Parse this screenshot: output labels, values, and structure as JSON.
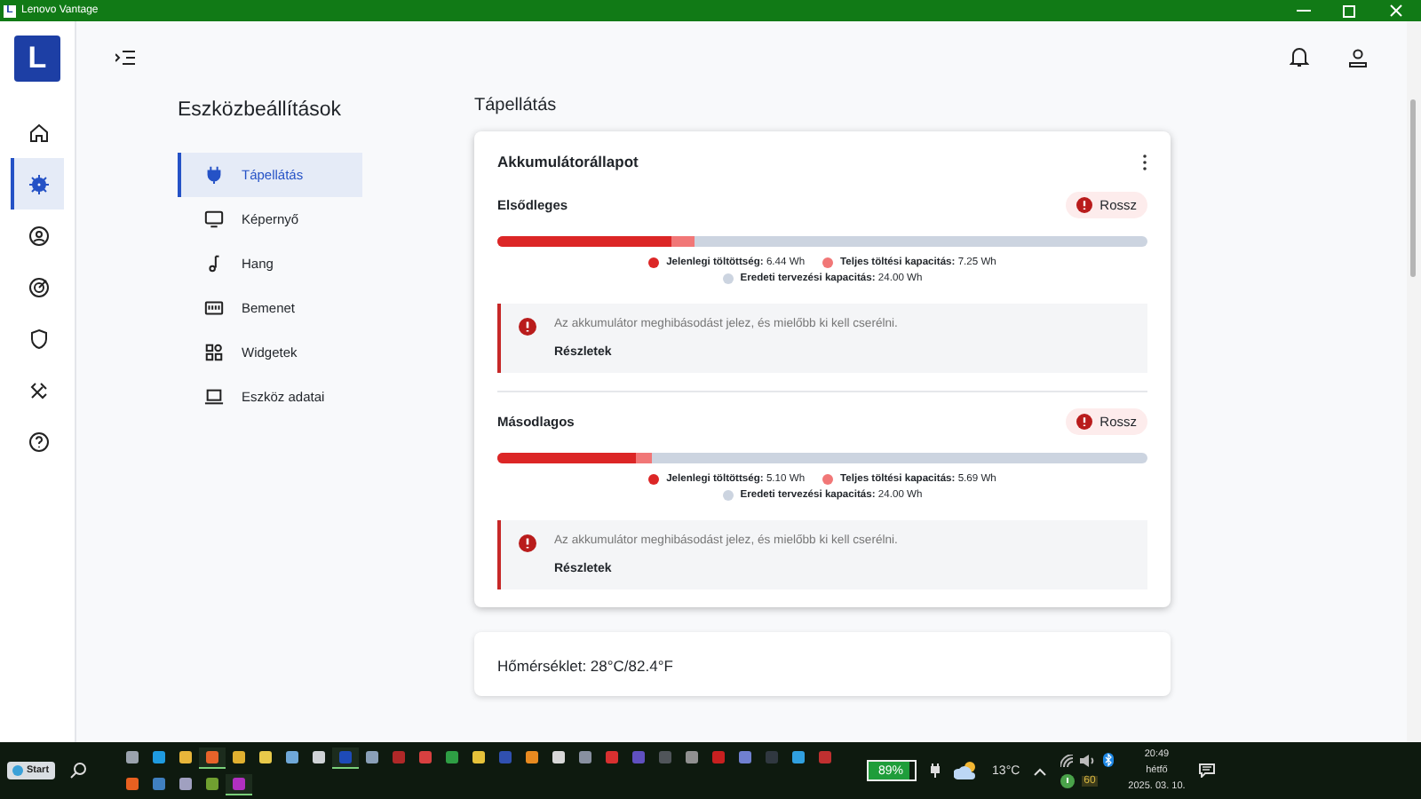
{
  "window": {
    "title": "Lenovo Vantage",
    "logo": "L"
  },
  "rail": {
    "logo": "L",
    "items": [
      {
        "kind": "home",
        "selected": false
      },
      {
        "kind": "gear",
        "selected": true
      },
      {
        "kind": "account",
        "selected": false
      },
      {
        "kind": "target",
        "selected": false
      },
      {
        "kind": "shield",
        "selected": false
      },
      {
        "kind": "tools",
        "selected": false
      },
      {
        "kind": "help",
        "selected": false
      }
    ]
  },
  "settings": {
    "title": "Eszközbeállítások",
    "items": [
      {
        "label": "Tápellátás",
        "kind": "plug",
        "selected": true
      },
      {
        "label": "Képernyő",
        "kind": "monitor",
        "selected": false
      },
      {
        "label": "Hang",
        "kind": "note",
        "selected": false
      },
      {
        "label": "Bemenet",
        "kind": "keyboard",
        "selected": false
      },
      {
        "label": "Widgetek",
        "kind": "widgets",
        "selected": false
      },
      {
        "label": "Eszköz adatai",
        "kind": "laptop",
        "selected": false
      }
    ]
  },
  "page": {
    "title": "Tápellátás"
  },
  "battery_card": {
    "title": "Akkumulátorállapot",
    "batteries": [
      {
        "name": "Elsődleges",
        "status": "Rossz",
        "current_label": "Jelenlegi töltöttség:",
        "current_value": "6.44 Wh",
        "full_label": "Teljes töltési kapacitás:",
        "full_value": "7.25 Wh",
        "design_label": "Eredeti tervezési kapacitás:",
        "design_value": "24.00 Wh",
        "charge": {
          "level": 0.268
        },
        "full_capacity": {
          "level": 0.302
        },
        "alert": "Az akkumulátor meghibásodást jelez, és mielőbb ki kell cserélni.",
        "details": "Részletek"
      },
      {
        "name": "Másodlagos",
        "status": "Rossz",
        "current_label": "Jelenlegi töltöttség:",
        "current_value": "5.10 Wh",
        "full_label": "Teljes töltési kapacitás:",
        "full_value": "5.69 Wh",
        "design_label": "Eredeti tervezési kapacitás:",
        "design_value": "24.00 Wh",
        "charge": {
          "level": 0.2125
        },
        "full_capacity": {
          "level": 0.237
        },
        "alert": "Az akkumulátor meghibásodást jelez, és mielőbb ki kell cserélni.",
        "details": "Részletek"
      }
    ]
  },
  "temperature_card": {
    "label": "Hőmérséklet:",
    "value": "28°C/82.4°F"
  },
  "taskbar": {
    "start": "Start",
    "apps": [
      {
        "color": "#9aa3ad",
        "active": false
      },
      {
        "color": "#1f9be0",
        "active": false
      },
      {
        "color": "#e8b53a",
        "active": false
      },
      {
        "color": "#e8632a",
        "active": true
      },
      {
        "color": "#e0b030",
        "active": false
      },
      {
        "color": "#e8c94a",
        "active": false
      },
      {
        "color": "#6fa8d8",
        "active": false
      },
      {
        "color": "#cfd3d6",
        "active": false
      },
      {
        "color": "#1e4bb8",
        "active": true
      },
      {
        "color": "#8aa0b8",
        "active": false
      },
      {
        "color": "#b02828",
        "active": false
      },
      {
        "color": "#d84040",
        "active": false
      },
      {
        "color": "#2e9e44",
        "active": false
      },
      {
        "color": "#e6c23a",
        "active": false
      },
      {
        "color": "#3050b0",
        "active": false
      },
      {
        "color": "#e88a20",
        "active": false
      },
      {
        "color": "#d8d8d8",
        "active": false
      },
      {
        "color": "#8890a0",
        "active": false
      },
      {
        "color": "#d83030",
        "active": false
      },
      {
        "color": "#6050c0",
        "active": false
      },
      {
        "color": "#50555a",
        "active": false
      },
      {
        "color": "#909090",
        "active": false
      },
      {
        "color": "#c82020",
        "active": false
      },
      {
        "color": "#7080d0",
        "active": false
      },
      {
        "color": "#303840",
        "active": false
      },
      {
        "color": "#30a0e0",
        "active": false
      },
      {
        "color": "#c03030",
        "active": false
      },
      {
        "color": "#e86020",
        "active": false
      },
      {
        "color": "#4080c0",
        "active": false
      },
      {
        "color": "#a0a0c0",
        "active": false
      },
      {
        "color": "#70a030",
        "active": false
      },
      {
        "color": "#b030c0",
        "active": true
      }
    ],
    "battery": "89%",
    "temperature": "13°C",
    "tray_badge": "60",
    "time": "20:49",
    "day": "hétfő",
    "date": "2025. 03. 10."
  }
}
